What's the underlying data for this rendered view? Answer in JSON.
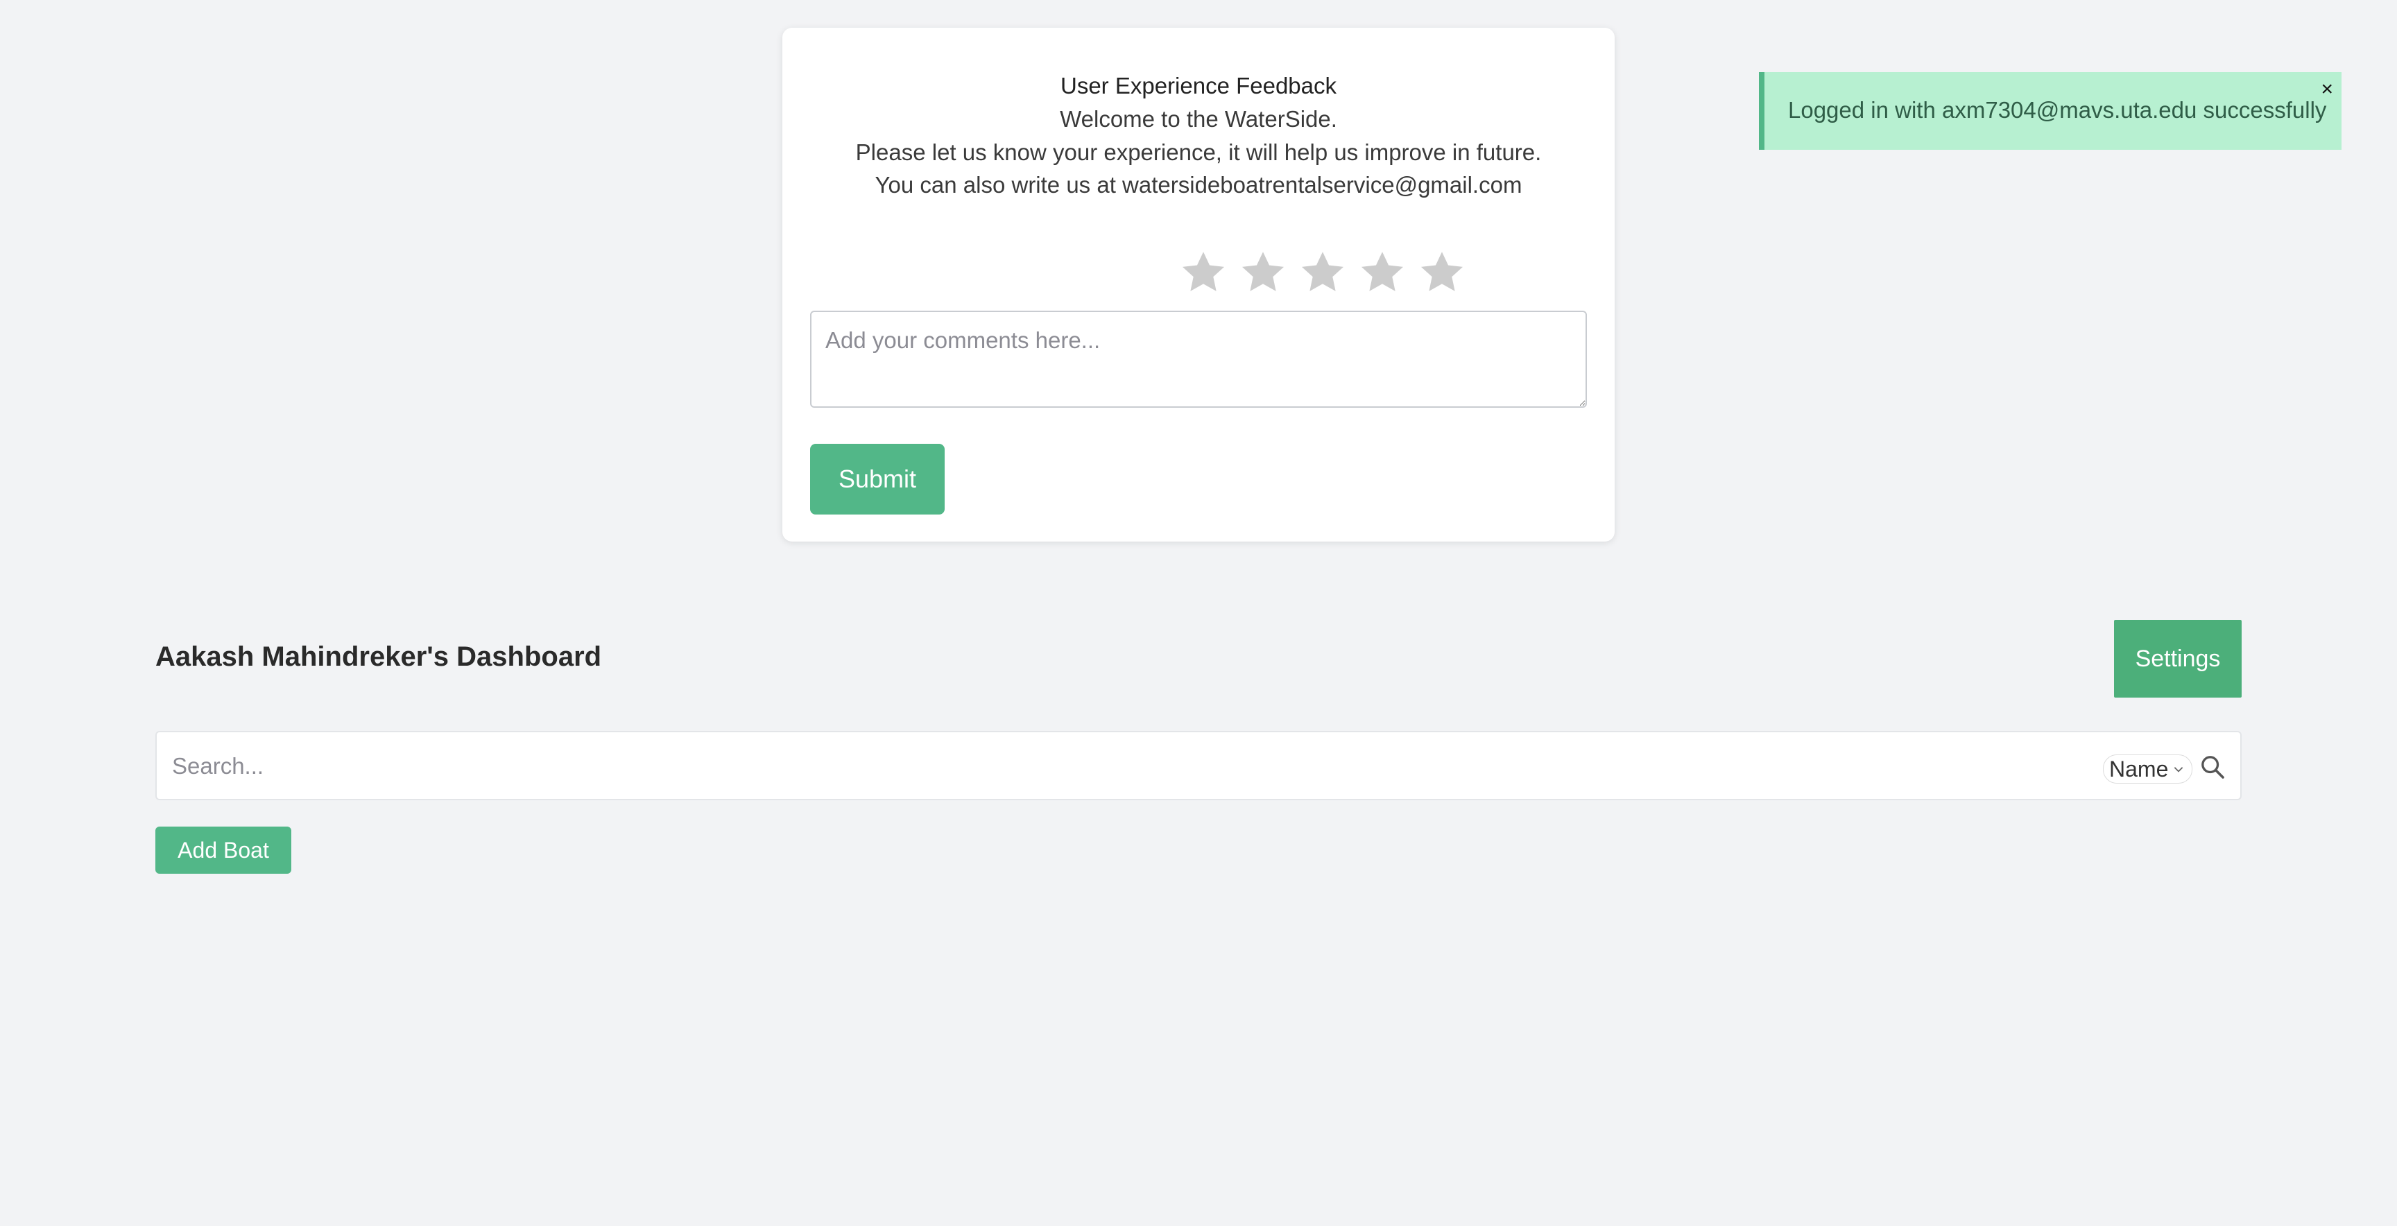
{
  "feedback": {
    "title": "User Experience Feedback",
    "line1": "Welcome to the WaterSide.",
    "line2": "Please let us know your experience, it will help us improve in future.",
    "line3": "You can also write us at watersideboatrentalservice@gmail.com",
    "rating": {
      "max": 5,
      "selected": 0,
      "star_color": "#cccccc"
    },
    "comment_placeholder": "Add your comments here...",
    "comment_value": "",
    "submit_label": "Submit"
  },
  "toast": {
    "message": "Logged in with axm7304@mavs.uta.edu successfully",
    "close_label": "×"
  },
  "dashboard": {
    "title": "Aakash Mahindreker's Dashboard",
    "settings_label": "Settings",
    "search": {
      "placeholder": "Search...",
      "value": "",
      "sort_selected": "Name",
      "icon": "search-icon"
    },
    "add_boat_label": "Add Boat"
  },
  "colors": {
    "accent_green": "#52b788",
    "settings_green": "#4caf7a",
    "toast_bg": "#b7f0d1",
    "page_bg": "#f2f3f5"
  }
}
